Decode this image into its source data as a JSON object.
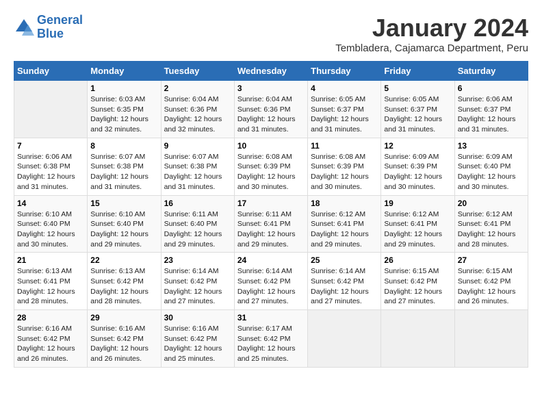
{
  "header": {
    "logo_line1": "General",
    "logo_line2": "Blue",
    "title": "January 2024",
    "subtitle": "Tembladera, Cajamarca Department, Peru"
  },
  "weekdays": [
    "Sunday",
    "Monday",
    "Tuesday",
    "Wednesday",
    "Thursday",
    "Friday",
    "Saturday"
  ],
  "weeks": [
    [
      {
        "day": "",
        "info": ""
      },
      {
        "day": "1",
        "info": "Sunrise: 6:03 AM\nSunset: 6:35 PM\nDaylight: 12 hours\nand 32 minutes."
      },
      {
        "day": "2",
        "info": "Sunrise: 6:04 AM\nSunset: 6:36 PM\nDaylight: 12 hours\nand 32 minutes."
      },
      {
        "day": "3",
        "info": "Sunrise: 6:04 AM\nSunset: 6:36 PM\nDaylight: 12 hours\nand 31 minutes."
      },
      {
        "day": "4",
        "info": "Sunrise: 6:05 AM\nSunset: 6:37 PM\nDaylight: 12 hours\nand 31 minutes."
      },
      {
        "day": "5",
        "info": "Sunrise: 6:05 AM\nSunset: 6:37 PM\nDaylight: 12 hours\nand 31 minutes."
      },
      {
        "day": "6",
        "info": "Sunrise: 6:06 AM\nSunset: 6:37 PM\nDaylight: 12 hours\nand 31 minutes."
      }
    ],
    [
      {
        "day": "7",
        "info": "Sunrise: 6:06 AM\nSunset: 6:38 PM\nDaylight: 12 hours\nand 31 minutes."
      },
      {
        "day": "8",
        "info": "Sunrise: 6:07 AM\nSunset: 6:38 PM\nDaylight: 12 hours\nand 31 minutes."
      },
      {
        "day": "9",
        "info": "Sunrise: 6:07 AM\nSunset: 6:38 PM\nDaylight: 12 hours\nand 31 minutes."
      },
      {
        "day": "10",
        "info": "Sunrise: 6:08 AM\nSunset: 6:39 PM\nDaylight: 12 hours\nand 30 minutes."
      },
      {
        "day": "11",
        "info": "Sunrise: 6:08 AM\nSunset: 6:39 PM\nDaylight: 12 hours\nand 30 minutes."
      },
      {
        "day": "12",
        "info": "Sunrise: 6:09 AM\nSunset: 6:39 PM\nDaylight: 12 hours\nand 30 minutes."
      },
      {
        "day": "13",
        "info": "Sunrise: 6:09 AM\nSunset: 6:40 PM\nDaylight: 12 hours\nand 30 minutes."
      }
    ],
    [
      {
        "day": "14",
        "info": "Sunrise: 6:10 AM\nSunset: 6:40 PM\nDaylight: 12 hours\nand 30 minutes."
      },
      {
        "day": "15",
        "info": "Sunrise: 6:10 AM\nSunset: 6:40 PM\nDaylight: 12 hours\nand 29 minutes."
      },
      {
        "day": "16",
        "info": "Sunrise: 6:11 AM\nSunset: 6:40 PM\nDaylight: 12 hours\nand 29 minutes."
      },
      {
        "day": "17",
        "info": "Sunrise: 6:11 AM\nSunset: 6:41 PM\nDaylight: 12 hours\nand 29 minutes."
      },
      {
        "day": "18",
        "info": "Sunrise: 6:12 AM\nSunset: 6:41 PM\nDaylight: 12 hours\nand 29 minutes."
      },
      {
        "day": "19",
        "info": "Sunrise: 6:12 AM\nSunset: 6:41 PM\nDaylight: 12 hours\nand 29 minutes."
      },
      {
        "day": "20",
        "info": "Sunrise: 6:12 AM\nSunset: 6:41 PM\nDaylight: 12 hours\nand 28 minutes."
      }
    ],
    [
      {
        "day": "21",
        "info": "Sunrise: 6:13 AM\nSunset: 6:41 PM\nDaylight: 12 hours\nand 28 minutes."
      },
      {
        "day": "22",
        "info": "Sunrise: 6:13 AM\nSunset: 6:42 PM\nDaylight: 12 hours\nand 28 minutes."
      },
      {
        "day": "23",
        "info": "Sunrise: 6:14 AM\nSunset: 6:42 PM\nDaylight: 12 hours\nand 27 minutes."
      },
      {
        "day": "24",
        "info": "Sunrise: 6:14 AM\nSunset: 6:42 PM\nDaylight: 12 hours\nand 27 minutes."
      },
      {
        "day": "25",
        "info": "Sunrise: 6:14 AM\nSunset: 6:42 PM\nDaylight: 12 hours\nand 27 minutes."
      },
      {
        "day": "26",
        "info": "Sunrise: 6:15 AM\nSunset: 6:42 PM\nDaylight: 12 hours\nand 27 minutes."
      },
      {
        "day": "27",
        "info": "Sunrise: 6:15 AM\nSunset: 6:42 PM\nDaylight: 12 hours\nand 26 minutes."
      }
    ],
    [
      {
        "day": "28",
        "info": "Sunrise: 6:16 AM\nSunset: 6:42 PM\nDaylight: 12 hours\nand 26 minutes."
      },
      {
        "day": "29",
        "info": "Sunrise: 6:16 AM\nSunset: 6:42 PM\nDaylight: 12 hours\nand 26 minutes."
      },
      {
        "day": "30",
        "info": "Sunrise: 6:16 AM\nSunset: 6:42 PM\nDaylight: 12 hours\nand 25 minutes."
      },
      {
        "day": "31",
        "info": "Sunrise: 6:17 AM\nSunset: 6:42 PM\nDaylight: 12 hours\nand 25 minutes."
      },
      {
        "day": "",
        "info": ""
      },
      {
        "day": "",
        "info": ""
      },
      {
        "day": "",
        "info": ""
      }
    ]
  ]
}
